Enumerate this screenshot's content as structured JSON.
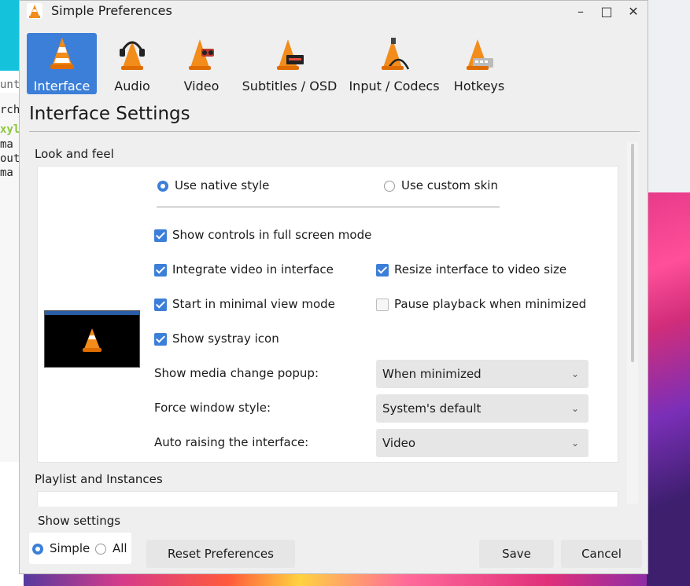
{
  "window": {
    "title": "Simple Preferences"
  },
  "toolbar": {
    "tabs": [
      {
        "label": "Interface",
        "icon": "vlc-cone-icon"
      },
      {
        "label": "Audio",
        "icon": "headphones-cone-icon"
      },
      {
        "label": "Video",
        "icon": "glasses-cone-icon"
      },
      {
        "label": "Subtitles / OSD",
        "icon": "subtitles-cone-icon"
      },
      {
        "label": "Input / Codecs",
        "icon": "cable-cone-icon"
      },
      {
        "label": "Hotkeys",
        "icon": "keyboard-cone-icon"
      }
    ]
  },
  "content": {
    "title": "Interface Settings",
    "look_and_feel": {
      "label": "Look and feel",
      "native_style": "Use native style",
      "custom_skin": "Use custom skin",
      "show_controls": "Show controls in full screen mode",
      "integrate_video": "Integrate video in interface",
      "resize_interface": "Resize interface to video size",
      "minimal_view": "Start in minimal view mode",
      "pause_minimized": "Pause playback when minimized",
      "systray": "Show systray icon",
      "popup_label": "Show media change popup:",
      "popup_value": "When minimized",
      "window_style_label": "Force window style:",
      "window_style_value": "System's default",
      "raising_label": "Auto raising the interface:",
      "raising_value": "Video"
    },
    "playlist": {
      "label": "Playlist and Instances"
    }
  },
  "footer": {
    "show_settings_label": "Show settings",
    "simple": "Simple",
    "all": "All",
    "reset": "Reset Preferences",
    "save": "Save",
    "cancel": "Cancel"
  },
  "desktop": {
    "terminal_lines": [
      "untu",
      "rch",
      "xyl",
      " ma",
      "out",
      " ma"
    ]
  },
  "colors": {
    "accent": "#3c7fd8",
    "cone_orange": "#f28c1a"
  }
}
